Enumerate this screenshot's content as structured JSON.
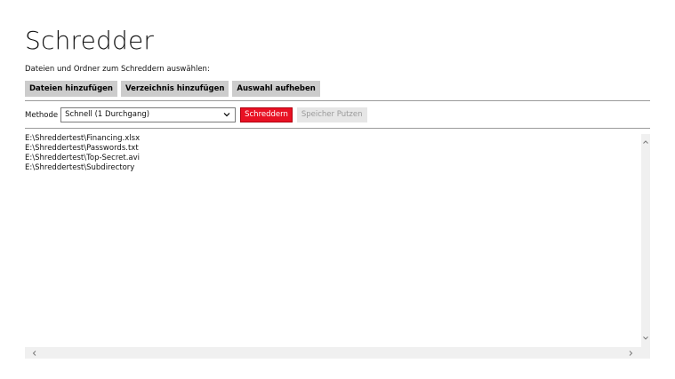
{
  "app": {
    "title": "Schredder",
    "subtitle": "Dateien und Ordner zum Schreddern auswählen:"
  },
  "toolbar": {
    "add_files_label": "Dateien hinzufügen",
    "add_folder_label": "Verzeichnis hinzufügen",
    "clear_selection_label": "Auswahl aufheben"
  },
  "method": {
    "label": "Methode",
    "selected": "Schnell (1 Durchgang)",
    "shred_label": "Schreddern",
    "wipe_memory_label": "Speicher Putzen"
  },
  "files": [
    "E:\\Shreddertest\\Financing.xlsx",
    "E:\\Shreddertest\\Passwords.txt",
    "E:\\Shreddertest\\Top-Secret.avi",
    "E:\\Shreddertest\\Subdirectory"
  ],
  "colors": {
    "accent": "#e81123",
    "button_gray": "#cccccc",
    "disabled_bg": "#e6e6e6"
  },
  "icons": {
    "dropdown": "chevron-down-icon",
    "scroll_up": "chevron-up-icon",
    "scroll_down": "chevron-down-icon",
    "scroll_left": "chevron-left-icon",
    "scroll_right": "chevron-right-icon"
  }
}
